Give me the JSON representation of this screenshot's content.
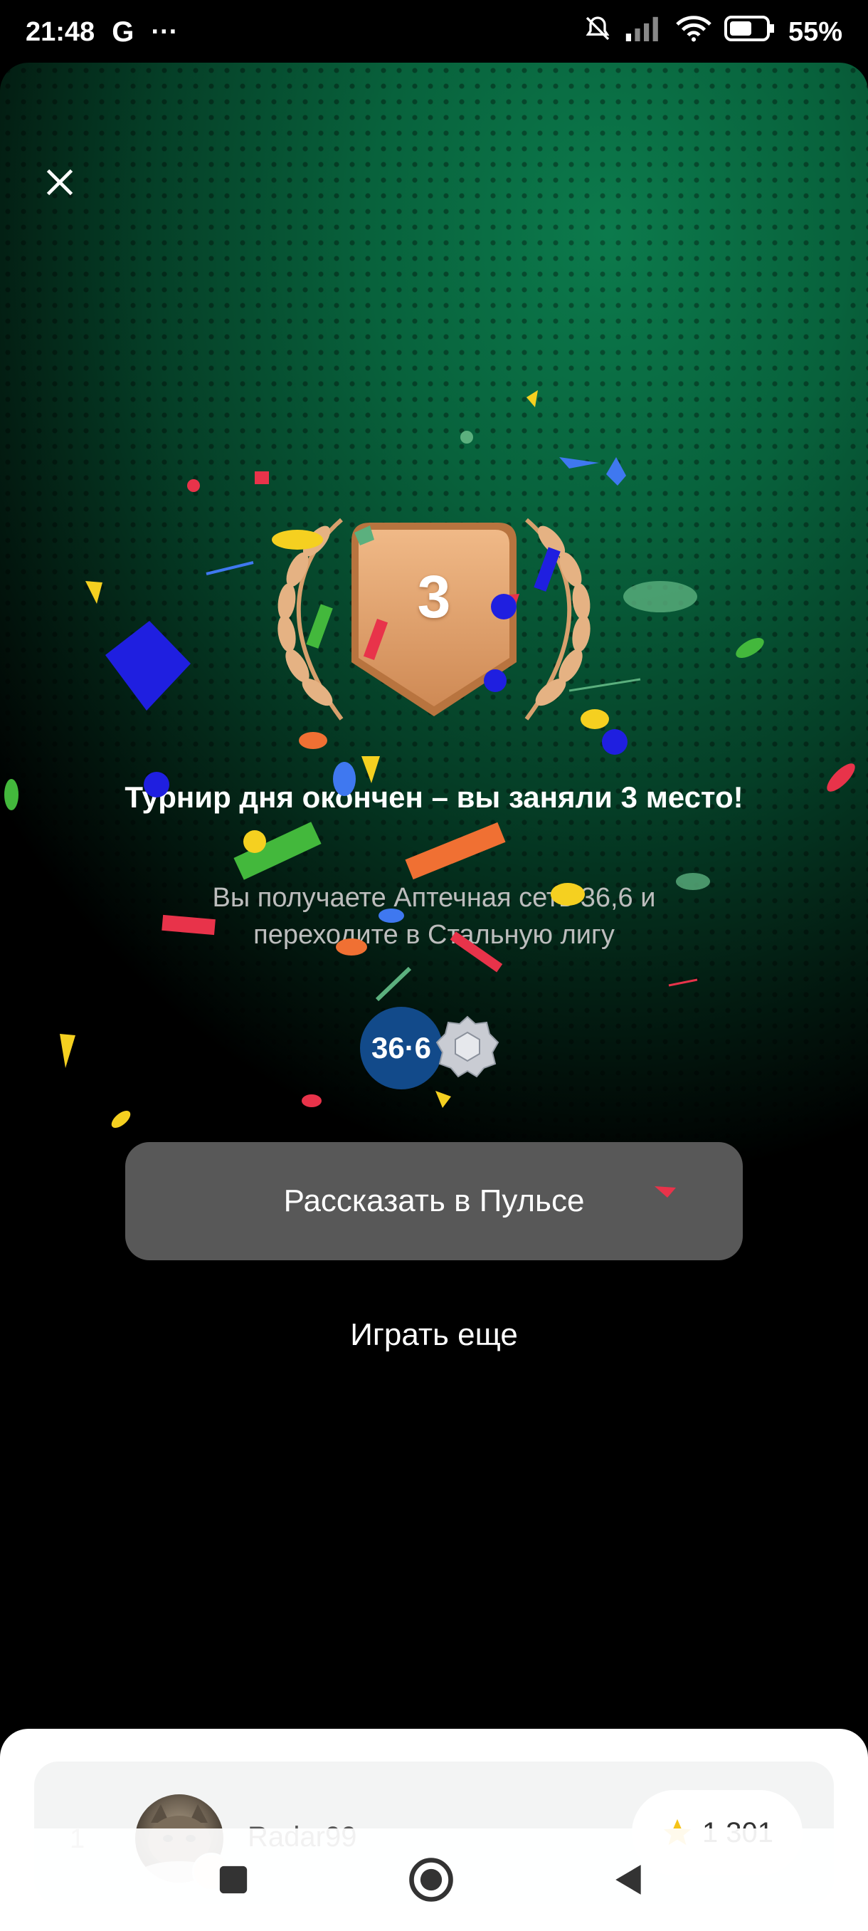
{
  "status_bar": {
    "time": "21:48",
    "carrier_icon": "G",
    "more": "···",
    "battery": "55%",
    "icons": [
      "mute-icon",
      "signal-icon",
      "wifi-icon",
      "battery-icon"
    ]
  },
  "result": {
    "place_number": "3",
    "title": "Турнир дня окончен – вы заняли 3 место!",
    "subtitle": "Вы получаете Аптечная сеть 36,6 и переходите в Стальную лигу",
    "reward_logo_text": "36·6"
  },
  "actions": {
    "share_label": "Рассказать в Пульсе",
    "play_again_label": "Играть еще"
  },
  "leaderboard": {
    "rows": [
      {
        "rank": "1",
        "name": "Radar99",
        "score": "1 301"
      }
    ]
  },
  "colors": {
    "accent_green": "#0c7a4c",
    "bronze": "#e2a06a",
    "share_button": "#585858",
    "reward_blue": "#124a8a"
  }
}
